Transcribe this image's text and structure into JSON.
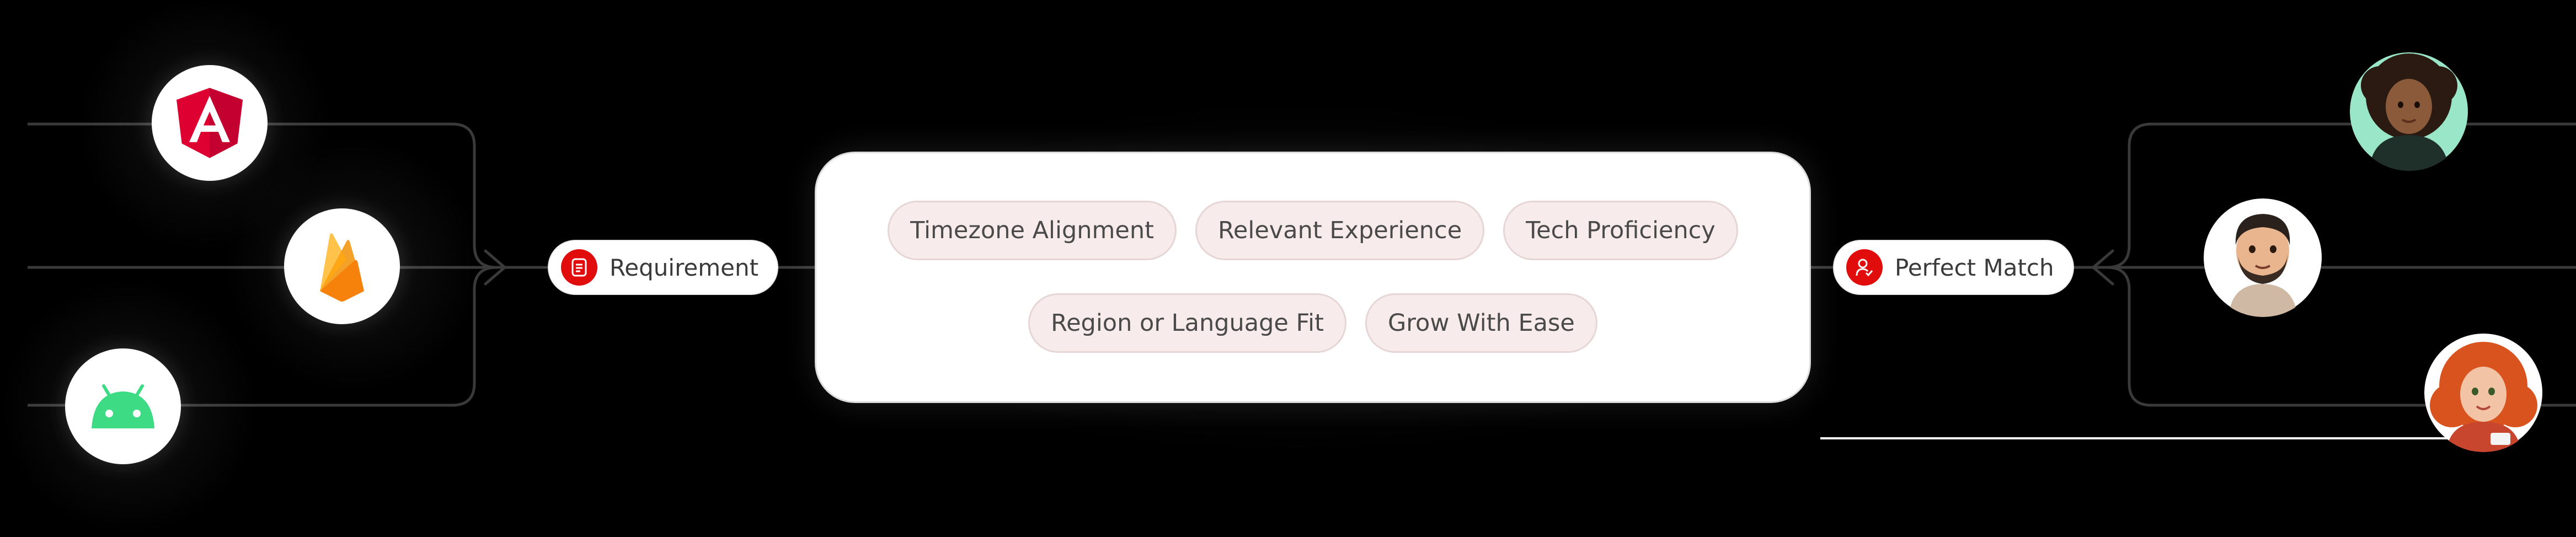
{
  "nodes": {
    "requirement_label": "Requirement",
    "perfect_match_label": "Perfect Match"
  },
  "criteria": {
    "row1": [
      "Timezone Alignment",
      "Relevant Experience",
      "Tech Proficiency"
    ],
    "row2": [
      "Region or Language Fit",
      "Grow With Ease"
    ]
  },
  "logos": [
    "angular-icon",
    "firebase-icon",
    "android-icon"
  ],
  "avatars": [
    "developer-avatar-woman-curly-hair",
    "developer-avatar-man-beard",
    "developer-avatar-woman-red-hair"
  ],
  "colors": {
    "accent": "#e10d0d",
    "chip_bg": "#f7ebeb",
    "background": "#000000",
    "android_green": "#3ddc84",
    "angular_red": "#dd0031"
  }
}
